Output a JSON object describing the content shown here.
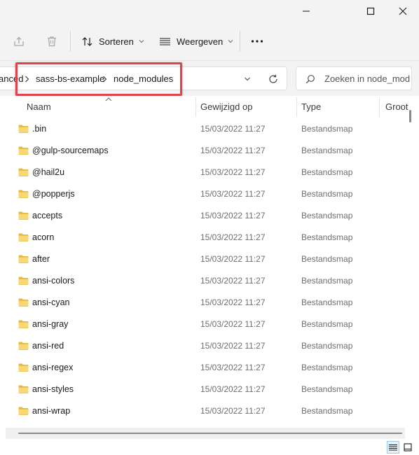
{
  "window": {
    "minimize_icon": "minimize-icon",
    "maximize_icon": "maximize-icon",
    "close_icon": "close-icon"
  },
  "toolbar": {
    "share_icon": "share-icon",
    "delete_icon": "trash-icon",
    "sort_label": "Sorteren",
    "view_label": "Weergeven",
    "more_icon": "more-dots-icon"
  },
  "address": {
    "crumbs": [
      "anced",
      "sass-bs-example",
      "node_modules"
    ],
    "history_icon": "chevron-down-icon",
    "refresh_icon": "refresh-icon"
  },
  "search": {
    "placeholder": "Zoeken in node_mod..."
  },
  "columns": {
    "name": "Naam",
    "modified": "Gewijzigd op",
    "type": "Type",
    "size": "Groot"
  },
  "files": [
    {
      "name": ".bin",
      "date": "15/03/2022 11:27",
      "type": "Bestandsmap"
    },
    {
      "name": "@gulp-sourcemaps",
      "date": "15/03/2022 11:27",
      "type": "Bestandsmap"
    },
    {
      "name": "@hail2u",
      "date": "15/03/2022 11:27",
      "type": "Bestandsmap"
    },
    {
      "name": "@popperjs",
      "date": "15/03/2022 11:27",
      "type": "Bestandsmap"
    },
    {
      "name": "accepts",
      "date": "15/03/2022 11:27",
      "type": "Bestandsmap"
    },
    {
      "name": "acorn",
      "date": "15/03/2022 11:27",
      "type": "Bestandsmap"
    },
    {
      "name": "after",
      "date": "15/03/2022 11:27",
      "type": "Bestandsmap"
    },
    {
      "name": "ansi-colors",
      "date": "15/03/2022 11:27",
      "type": "Bestandsmap"
    },
    {
      "name": "ansi-cyan",
      "date": "15/03/2022 11:27",
      "type": "Bestandsmap"
    },
    {
      "name": "ansi-gray",
      "date": "15/03/2022 11:27",
      "type": "Bestandsmap"
    },
    {
      "name": "ansi-red",
      "date": "15/03/2022 11:27",
      "type": "Bestandsmap"
    },
    {
      "name": "ansi-regex",
      "date": "15/03/2022 11:27",
      "type": "Bestandsmap"
    },
    {
      "name": "ansi-styles",
      "date": "15/03/2022 11:27",
      "type": "Bestandsmap"
    },
    {
      "name": "ansi-wrap",
      "date": "15/03/2022 11:27",
      "type": "Bestandsmap"
    }
  ],
  "colors": {
    "highlight": "#e0434a",
    "folder": "#f8d775",
    "chrome": "#f3f3f3"
  }
}
